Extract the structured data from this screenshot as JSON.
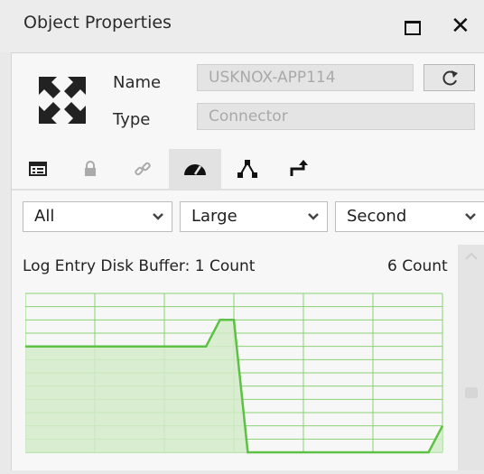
{
  "window": {
    "title": "Object Properties",
    "maximize_icon": "maximize-icon",
    "close_icon": "close-icon"
  },
  "object": {
    "icon": "expand-arrows-icon",
    "name_label": "Name",
    "name_value": "USKNOX-APP114",
    "type_label": "Type",
    "type_value": "Connector",
    "refresh_icon": "refresh-icon"
  },
  "tabs": [
    {
      "icon": "list-view-icon",
      "active": false
    },
    {
      "icon": "lock-icon",
      "active": false
    },
    {
      "icon": "link-icon",
      "active": false
    },
    {
      "icon": "gauge-icon",
      "active": true
    },
    {
      "icon": "topology-icon",
      "active": false
    },
    {
      "icon": "route-arrow-icon",
      "active": false
    }
  ],
  "filters": {
    "scope": "All",
    "size": "Large",
    "interval": "Second"
  },
  "chart_data": {
    "type": "area",
    "title": "Log Entry Disk Buffer: 1 Count",
    "max_label": "6 Count",
    "x": [
      0,
      1,
      2,
      3,
      4,
      5,
      6,
      7,
      8,
      9,
      10,
      11,
      12,
      13,
      14,
      15,
      16,
      17,
      18,
      19,
      20,
      21,
      22,
      23,
      24,
      25,
      26,
      27,
      28,
      29,
      30
    ],
    "values": [
      4,
      4,
      4,
      4,
      4,
      4,
      4,
      4,
      4,
      4,
      4,
      4,
      4,
      4,
      5,
      5,
      0,
      0,
      0,
      0,
      0,
      0,
      0,
      0,
      0,
      0,
      0,
      0,
      0,
      0,
      1
    ],
    "ylim": [
      0,
      6
    ],
    "grid": true,
    "colors": {
      "line": "#5cc144",
      "fill": "#d3ebc9",
      "grid": "#8ad373"
    }
  }
}
